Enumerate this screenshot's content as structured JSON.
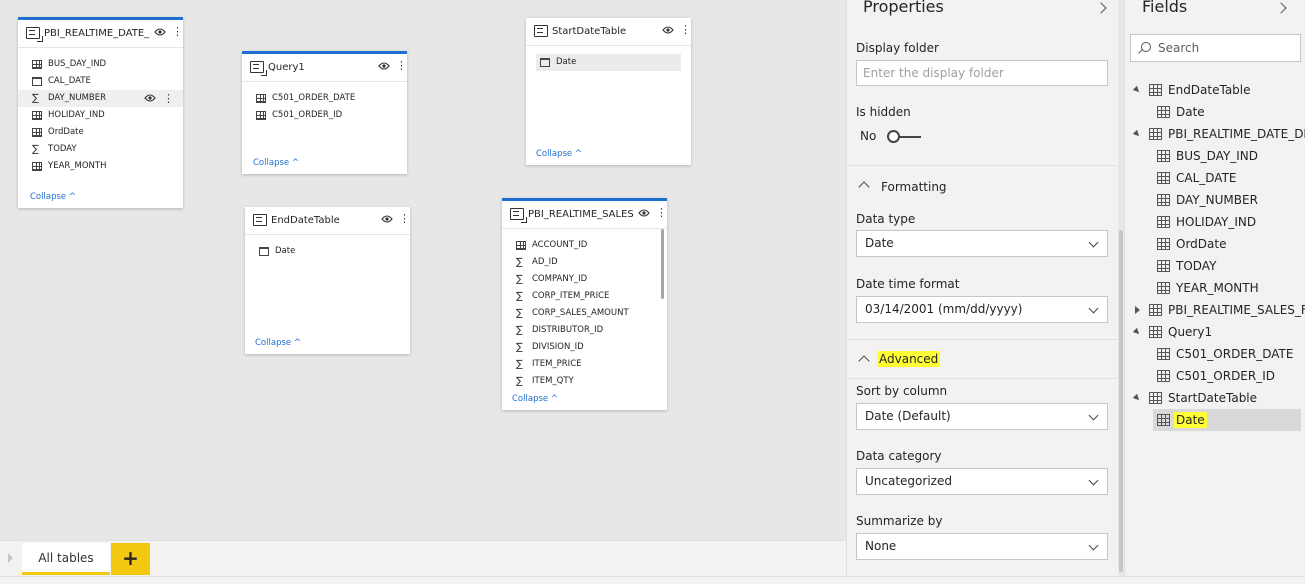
{
  "canvas": {
    "tables": [
      {
        "title": "PBI_REALTIME_DATE_...",
        "fields": [
          "BUS_DAY_IND",
          "CAL_DATE",
          "DAY_NUMBER",
          "HOLIDAY_IND",
          "OrdDate",
          "TODAY",
          "YEAR_MONTH"
        ],
        "collapse": "Collapse"
      },
      {
        "title": "Query1",
        "fields": [
          "C501_ORDER_DATE",
          "C501_ORDER_ID"
        ],
        "collapse": "Collapse"
      },
      {
        "title": "StartDateTable",
        "fields": [
          "Date"
        ],
        "collapse": "Collapse"
      },
      {
        "title": "EndDateTable",
        "fields": [
          "Date"
        ],
        "collapse": "Collapse"
      },
      {
        "title": "PBI_REALTIME_SALES...",
        "fields": [
          "ACCOUNT_ID",
          "AD_ID",
          "COMPANY_ID",
          "CORP_ITEM_PRICE",
          "CORP_SALES_AMOUNT",
          "DISTRIBUTOR_ID",
          "DIVISION_ID",
          "ITEM_PRICE",
          "ITEM_QTY"
        ],
        "collapse": "Collapse"
      }
    ]
  },
  "tabs": {
    "all_tables": "All tables",
    "add": "+"
  },
  "properties": {
    "title": "Properties",
    "display_folder_label": "Display folder",
    "display_folder_placeholder": "Enter the display folder",
    "is_hidden_label": "Is hidden",
    "is_hidden_value": "No",
    "formatting_label": "Formatting",
    "data_type_label": "Data type",
    "data_type_value": "Date",
    "date_time_format_label": "Date time format",
    "date_time_format_value": "03/14/2001 (mm/dd/yyyy)",
    "advanced_label": "Advanced",
    "sort_by_label": "Sort by column",
    "sort_by_value": "Date (Default)",
    "data_category_label": "Data category",
    "data_category_value": "Uncategorized",
    "summarize_by_label": "Summarize by",
    "summarize_by_value": "None"
  },
  "fields_pane": {
    "title": "Fields",
    "search_placeholder": "Search",
    "tree": [
      {
        "label": "EndDateTable",
        "level": 0,
        "state": "expanded"
      },
      {
        "label": "Date",
        "level": 1
      },
      {
        "label": "PBI_REALTIME_DATE_DIM",
        "level": 0,
        "state": "expanded"
      },
      {
        "label": "BUS_DAY_IND",
        "level": 1
      },
      {
        "label": "CAL_DATE",
        "level": 1
      },
      {
        "label": "DAY_NUMBER",
        "level": 1
      },
      {
        "label": "HOLIDAY_IND",
        "level": 1
      },
      {
        "label": "OrdDate",
        "level": 1
      },
      {
        "label": "TODAY",
        "level": 1
      },
      {
        "label": "YEAR_MONTH",
        "level": 1
      },
      {
        "label": "PBI_REALTIME_SALES_FA...",
        "level": 0,
        "state": "collapsed"
      },
      {
        "label": "Query1",
        "level": 0,
        "state": "expanded"
      },
      {
        "label": "C501_ORDER_DATE",
        "level": 1
      },
      {
        "label": "C501_ORDER_ID",
        "level": 1
      },
      {
        "label": "StartDateTable",
        "level": 0,
        "state": "expanded"
      },
      {
        "label": "Date",
        "level": 1,
        "selected": true
      }
    ]
  },
  "colors": {
    "accent_blue": "#1f6fd1",
    "highlight_yellow": "#ffff33",
    "tab_yellow": "#f2c811"
  }
}
